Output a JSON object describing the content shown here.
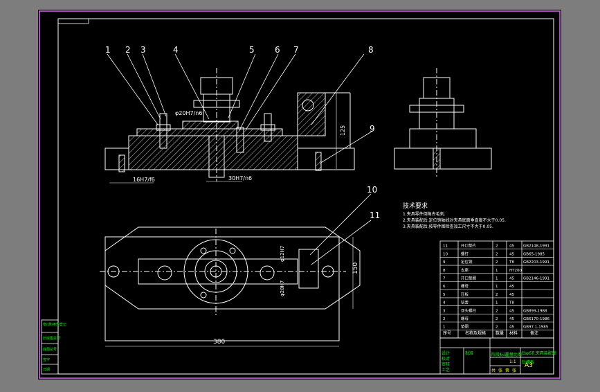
{
  "drawing": {
    "colors": {
      "background": "#7d7d7d",
      "sheet": "#000000",
      "outer_frame": "#e066ff",
      "lines": "#ffffff",
      "hatch": "#ffffff",
      "title_green": "#00ff00",
      "title_yellow": "#ffff00",
      "title_cyan": "#00ffff"
    },
    "balloons": [
      "1",
      "2",
      "3",
      "4",
      "5",
      "6",
      "7",
      "8",
      "9",
      "10",
      "11"
    ],
    "dimensions": {
      "bore_dia": "φ20H7/n6",
      "pin_fit": "16H7/f6",
      "bush_fit": "30H7/n6",
      "height": "125",
      "length": "380",
      "width": "150",
      "dia_upper": "φ12H7",
      "dia_lower": "φ28H7"
    },
    "technical_requirements": {
      "title": "技术要求",
      "lines": [
        "1.夹具零件倒角去毛刺.",
        "2.夹具装配后,定位销轴线对夹具底面垂直度不大于0.05.",
        "3.夹具装配后,按零件图检查加工尺寸不大于0.05."
      ]
    },
    "parts_list": {
      "rows": [
        {
          "no": "11",
          "name": "开口垫片",
          "qty": "2",
          "material": "45",
          "standard": "GB2148-1991"
        },
        {
          "no": "10",
          "name": "螺钉",
          "qty": "2",
          "material": "45",
          "standard": "GB65-1985"
        },
        {
          "no": "9",
          "name": "定位销",
          "qty": "2",
          "material": "T8",
          "standard": "GB2203-1991"
        },
        {
          "no": "8",
          "name": "支座",
          "qty": "1",
          "material": "HT200",
          "standard": ""
        },
        {
          "no": "7",
          "name": "开口垫圈",
          "qty": "1",
          "material": "45",
          "standard": "GB2146-1991"
        },
        {
          "no": "6",
          "name": "螺母",
          "qty": "1",
          "material": "45",
          "standard": ""
        },
        {
          "no": "5",
          "name": "压板",
          "qty": "2",
          "material": "45",
          "standard": ""
        },
        {
          "no": "4",
          "name": "钻套",
          "qty": "1",
          "material": "T8",
          "standard": ""
        },
        {
          "no": "3",
          "name": "双头螺柱",
          "qty": "2",
          "material": "45",
          "standard": "GB899-1988"
        },
        {
          "no": "2",
          "name": "螺母",
          "qty": "2",
          "material": "45",
          "standard": "GB6170-1986"
        },
        {
          "no": "1",
          "name": "垫圈",
          "qty": "2",
          "material": "45",
          "standard": "GB97.1-1985"
        }
      ],
      "header": {
        "no": "序号",
        "name": "名称及规格",
        "qty": "数量",
        "material": "材料",
        "standard": "备注"
      }
    },
    "title_block": {
      "main_title": "钻φ6孔夹具装配图",
      "sub_title": "钻模板",
      "drawing_no": "A3",
      "scale": "1:1",
      "left_labels": [
        "设计",
        "校对",
        "审核",
        "工艺",
        "批准"
      ],
      "side_labels": [
        "借(通)用件登记",
        "旧底图总号",
        "底图总号",
        "签字",
        "日期"
      ],
      "stage_labels": [
        "阶段标记",
        "重量",
        "比例"
      ],
      "sheet_marks": [
        "共",
        "张",
        "第",
        "张"
      ]
    }
  }
}
